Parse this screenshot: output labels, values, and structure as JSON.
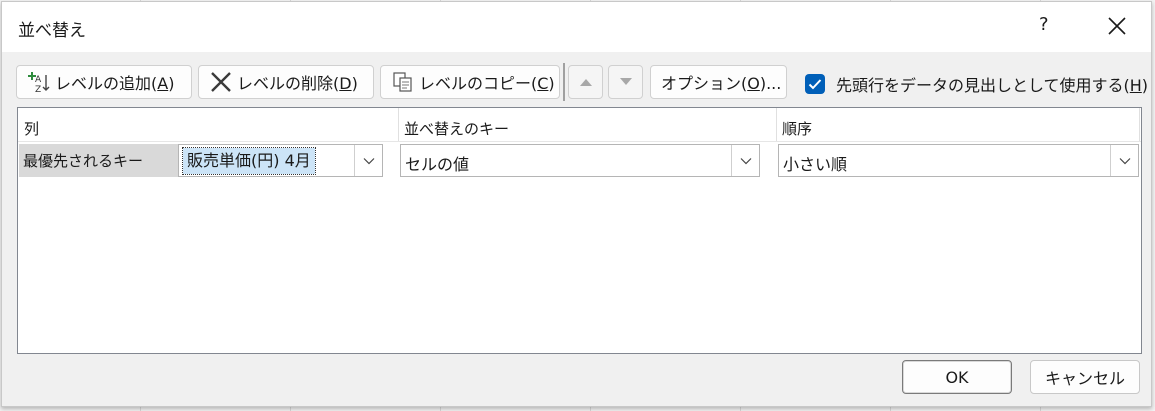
{
  "dialog": {
    "title": "並べ替え",
    "help_label": "?",
    "toolbar": {
      "add_level_prefix": "レベルの追加(",
      "add_level_key": "A",
      "add_level_suffix": ")",
      "delete_level_prefix": "レベルの削除(",
      "delete_level_key": "D",
      "delete_level_suffix": ")",
      "copy_level_prefix": "レベルのコピー(",
      "copy_level_key": "C",
      "copy_level_suffix": ")",
      "options_prefix": "オプション(",
      "options_key": "O",
      "options_suffix": ")...",
      "header_checkbox_prefix": "先頭行をデータの見出しとして使用する(",
      "header_checkbox_key": "H",
      "header_checkbox_suffix": ")",
      "header_checkbox_checked": true
    },
    "grid": {
      "columns": [
        "列",
        "並べ替えのキー",
        "順序"
      ],
      "rows": [
        {
          "label": "最優先されるキー",
          "column_value": "販売単価(円) 4月",
          "sort_on_value": "セルの値",
          "order_value": "小さい順"
        }
      ]
    },
    "ok_label": "OK",
    "cancel_label": "キャンセル"
  },
  "colors": {
    "accent": "#005fb8",
    "selection": "#cce4f7"
  }
}
